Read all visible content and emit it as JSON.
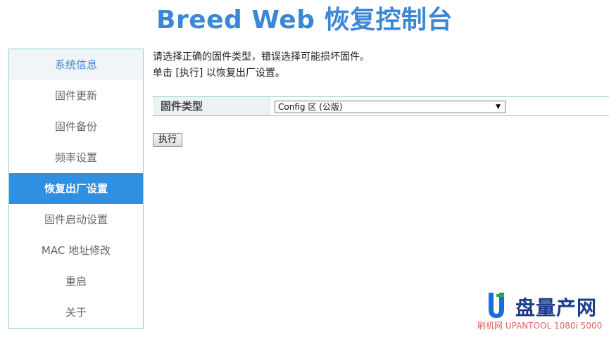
{
  "header": {
    "title": "Breed Web 恢复控制台"
  },
  "sidebar": {
    "items": [
      {
        "label": "系统信息"
      },
      {
        "label": "固件更新"
      },
      {
        "label": "固件备份"
      },
      {
        "label": "频率设置"
      },
      {
        "label": "恢复出厂设置"
      },
      {
        "label": "固件启动设置"
      },
      {
        "label": "MAC 地址修改"
      },
      {
        "label": "重启"
      },
      {
        "label": "关于"
      }
    ],
    "active_index": 4
  },
  "main": {
    "line1": "请选择正确的固件类型，错误选择可能损坏固件。",
    "line2": "单击 [执行] 以恢复出厂设置。",
    "firmware_label": "固件类型",
    "firmware_selected": "Config 区 (公版)",
    "execute_label": "执行"
  },
  "watermark": {
    "brand": "盘量产网",
    "sub": "刷机网 UPANTOOL 1080i 5000"
  },
  "colors": {
    "accent": "#3b87d6",
    "active_nav": "#2f8fe0",
    "border": "#8fd3d3"
  }
}
